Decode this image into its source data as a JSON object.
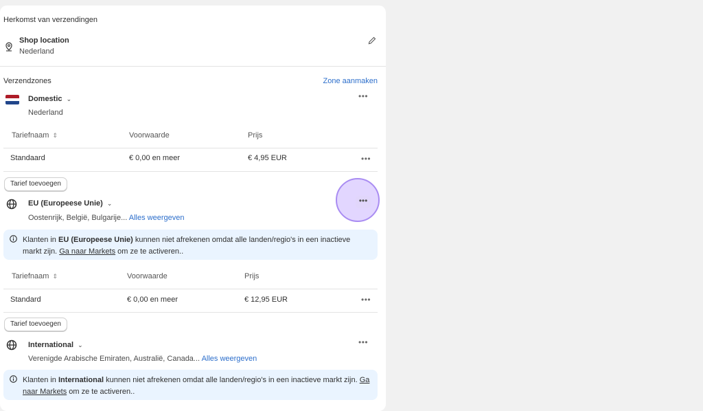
{
  "origin": {
    "title": "Herkomst van verzendingen",
    "location_name": "Shop location",
    "location_country": "Nederland"
  },
  "zones": {
    "title": "Verzendzones",
    "create_link": "Zone aanmaken"
  },
  "domestic": {
    "name": "Domestic",
    "countries": "Nederland",
    "headers": [
      "Tariefnaam",
      "Voorwaarde",
      "Prijs"
    ],
    "rate": {
      "name": "Standaard",
      "condition": "€ 0,00 en meer",
      "price": "€ 4,95 EUR"
    },
    "add_button": "Tarief toevoegen"
  },
  "eu": {
    "name": "EU (Europeese Unie)",
    "countries": "Oostenrijk, België, Bulgarije...",
    "show_all": "Alles weergeven",
    "banner": {
      "prefix": "Klanten in",
      "zone": "EU (Europeese Unie)",
      "text": "kunnen niet afrekenen omdat alle landen/regio's in een inactieve markt zijn.",
      "link": "Ga naar Markets",
      "suffix": "om ze te activeren.."
    },
    "headers": [
      "Tariefnaam",
      "Voorwaarde",
      "Prijs"
    ],
    "rate": {
      "name": "Standard",
      "condition": "€ 0,00 en meer",
      "price": "€ 12,95 EUR"
    },
    "add_button": "Tarief toevoegen"
  },
  "international": {
    "name": "International",
    "countries": "Verenigde Arabische Emiraten, Australië, Canada...",
    "show_all": "Alles weergeven",
    "banner": {
      "prefix": "Klanten in",
      "zone": "International",
      "text": "kunnen niet afrekenen omdat alle landen/regio's in een inactieve markt zijn.",
      "link": "Ga naar Markets",
      "suffix": "om ze te activeren.."
    }
  },
  "icons": {
    "more": "•••",
    "info": "info-icon",
    "globe": "globe-icon",
    "pin": "location-pin-icon",
    "pencil": "pencil-icon"
  },
  "colors": {
    "link": "#2c6ecb",
    "banner_bg": "#eaf4ff",
    "highlight": "#a98cf2"
  }
}
